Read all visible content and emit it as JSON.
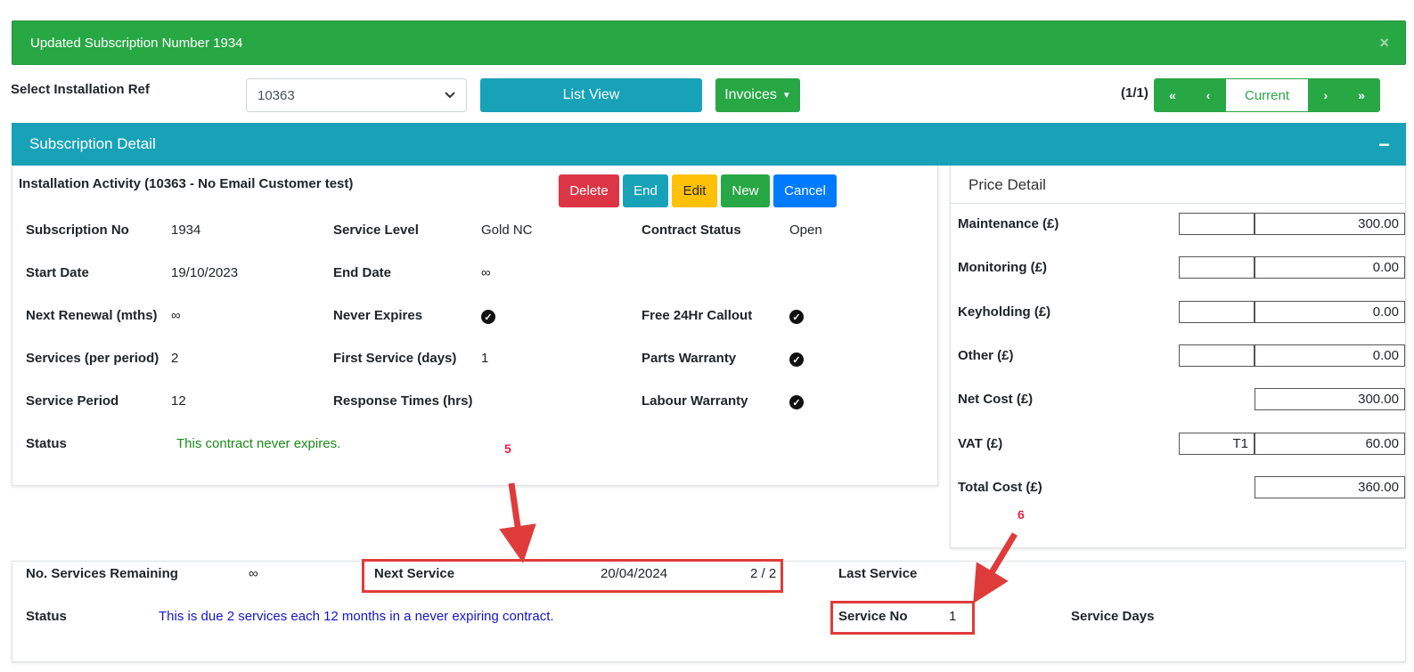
{
  "alert": {
    "message": "Updated Subscription Number 1934",
    "close": "×"
  },
  "toolbar": {
    "select_label": "Select Installation Ref",
    "select_value": "10363",
    "list_view": "List View",
    "invoices": "Invoices",
    "page_count": "(1/1)",
    "pager": {
      "first": "«",
      "prev": "‹",
      "current": "Current",
      "next": "›",
      "last": "»"
    }
  },
  "card": {
    "title": "Subscription Detail",
    "collapse": "−"
  },
  "activity": {
    "title": "Installation Activity (10363 - No Email Customer test)",
    "buttons": {
      "delete": "Delete",
      "end": "End",
      "edit": "Edit",
      "new": "New",
      "cancel": "Cancel"
    }
  },
  "details": {
    "subscription_no": {
      "label": "Subscription No",
      "value": "1934"
    },
    "service_level": {
      "label": "Service Level",
      "value": "Gold NC"
    },
    "contract_status": {
      "label": "Contract Status",
      "value": "Open"
    },
    "start_date": {
      "label": "Start Date",
      "value": "19/10/2023"
    },
    "end_date": {
      "label": "End Date",
      "value": "∞"
    },
    "next_renewal": {
      "label": "Next Renewal (mths)",
      "value": "∞"
    },
    "never_expires": {
      "label": "Never Expires",
      "checked": true
    },
    "free_callout": {
      "label": "Free 24Hr Callout",
      "checked": true
    },
    "services_per_period": {
      "label": "Services (per period)",
      "value": "2"
    },
    "first_service": {
      "label": "First Service (days)",
      "value": "1"
    },
    "parts_warranty": {
      "label": "Parts Warranty",
      "checked": true
    },
    "service_period": {
      "label": "Service Period",
      "value": "12"
    },
    "response_times": {
      "label": "Response Times (hrs)",
      "value": ""
    },
    "labour_warranty": {
      "label": "Labour Warranty",
      "checked": true
    },
    "status": {
      "label": "Status",
      "value": "This contract never expires."
    }
  },
  "price": {
    "title": "Price Detail",
    "rows": [
      {
        "label": "Maintenance (£)",
        "small": "",
        "value": "300.00"
      },
      {
        "label": "Monitoring (£)",
        "small": "",
        "value": "0.00"
      },
      {
        "label": "Keyholding (£)",
        "small": "",
        "value": "0.00"
      },
      {
        "label": "Other (£)",
        "small": "",
        "value": "0.00"
      },
      {
        "label": "Net Cost (£)",
        "value": "300.00"
      },
      {
        "label": "VAT (£)",
        "small": "T1",
        "value": "60.00"
      },
      {
        "label": "Total Cost (£)",
        "value": "360.00"
      }
    ]
  },
  "services": {
    "remaining_label": "No. Services Remaining",
    "remaining_value": "∞",
    "next_label": "Next Service",
    "next_date": "20/04/2024",
    "next_count": "2 / 2",
    "last_label": "Last Service",
    "status_label": "Status",
    "status_value": "This is due 2 services each 12 months in a never expiring contract.",
    "service_no_label": "Service No",
    "service_no_value": "1",
    "service_days_label": "Service Days"
  },
  "annotations": {
    "a5": "5",
    "a6": "6"
  },
  "colors": {
    "success": "#28a745",
    "info": "#17a2b8",
    "danger": "#dc3545",
    "warning": "#ffc107",
    "primary": "#007bff",
    "annotation": "#e03b3b"
  }
}
